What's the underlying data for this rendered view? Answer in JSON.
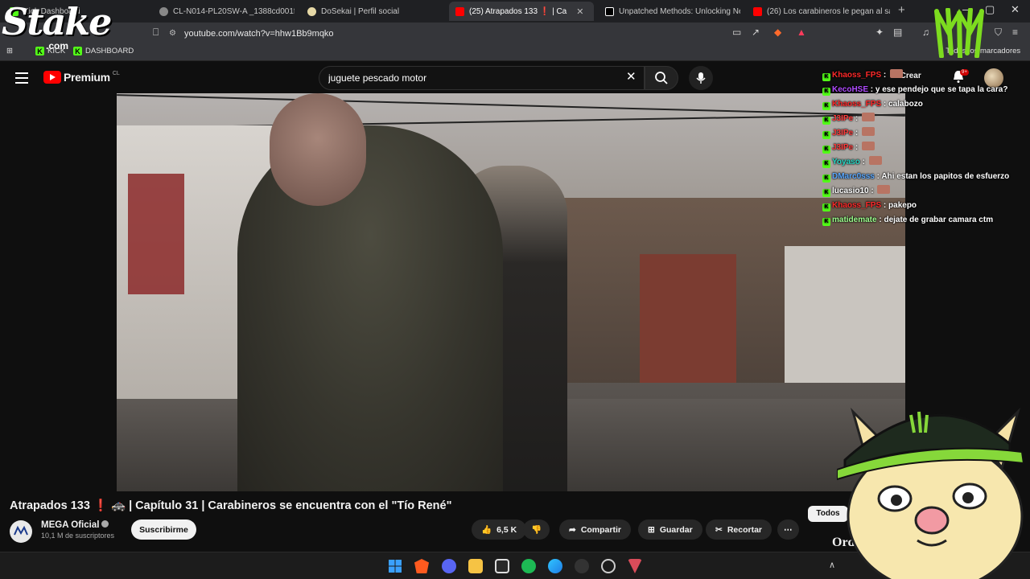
{
  "tabs": [
    {
      "label": "Kick Dashboard",
      "color": "#53fc18"
    },
    {
      "label": "CL-N014-PL20SW-A _1388cd001ff64",
      "color": "#aaaaaa"
    },
    {
      "label": "DoSekai | Perfil social",
      "color": "#e6d8a6"
    },
    {
      "label": "(25) Atrapados 133 ❗ | Ca",
      "color": "#ff0000"
    },
    {
      "label": "Unpatched Methods: Unlocking New",
      "color": "#ffffff"
    },
    {
      "label": "(26) Los carabineros le pegan al sayia",
      "color": "#ff0000"
    }
  ],
  "address": {
    "url": "youtube.com/watch?v=hhw1Bb9mqko"
  },
  "bookmarks": {
    "kick": "KICK",
    "dashboard": "DASHBOARD",
    "all": "Todos los marcadores"
  },
  "youtube": {
    "logo": "Premium",
    "country": "CL",
    "search_value": "juguete pescado motor",
    "create": "Crear",
    "notif_count": "9+"
  },
  "chat": [
    {
      "user": "Khaoss_FPS",
      "text": "",
      "color": "#ff2a2a",
      "emote": true
    },
    {
      "user": "KecoHSE",
      "text": "y ese pendejo que se tapa la cara?",
      "color": "#b04bff",
      "emote": false
    },
    {
      "user": "Khaoss_FPS",
      "text": "calabozo",
      "color": "#ff2a2a",
      "emote": false
    },
    {
      "user": "J3IPe",
      "text": "",
      "color": "#ff3b3b",
      "emote": true
    },
    {
      "user": "J3IPe",
      "text": "",
      "color": "#ff3b3b",
      "emote": true
    },
    {
      "user": "J3IPe",
      "text": "",
      "color": "#ff3b3b",
      "emote": true
    },
    {
      "user": "Yoyaso",
      "text": "",
      "color": "#27d7c4",
      "emote": true
    },
    {
      "user": "DMarc0sss",
      "text": "Ahi estan los papitos de esfuerzo",
      "color": "#5aa8ff",
      "emote": false
    },
    {
      "user": "lucasio10",
      "text": "",
      "color": "#ffffff",
      "emote": true
    },
    {
      "user": "Khaoss_FPS",
      "text": "pakepo",
      "color": "#ff2a2a",
      "emote": false
    },
    {
      "user": "matidemate",
      "text": "dejate de grabar camara ctm",
      "color": "#9dff8e",
      "emote": false
    }
  ],
  "video": {
    "title_a": "Atrapados 133",
    "title_b": "❗",
    "title_c": "🚓 | Capítulo 31 | Carabineros se encuentra con el \"Tío René\""
  },
  "channel": {
    "name": "MEGA Oficial",
    "subs": "10,1 M de suscriptores",
    "subscribe": "Suscribirme"
  },
  "actions": {
    "likes": "6,5 K",
    "share": "Compartir",
    "save": "Guardar",
    "clip": "Recortar",
    "more": "⋯"
  },
  "side": {
    "filter": "Todos",
    "partial": "Ord"
  },
  "overlay": {
    "stake": "Stake",
    "stake_com": ".com"
  }
}
